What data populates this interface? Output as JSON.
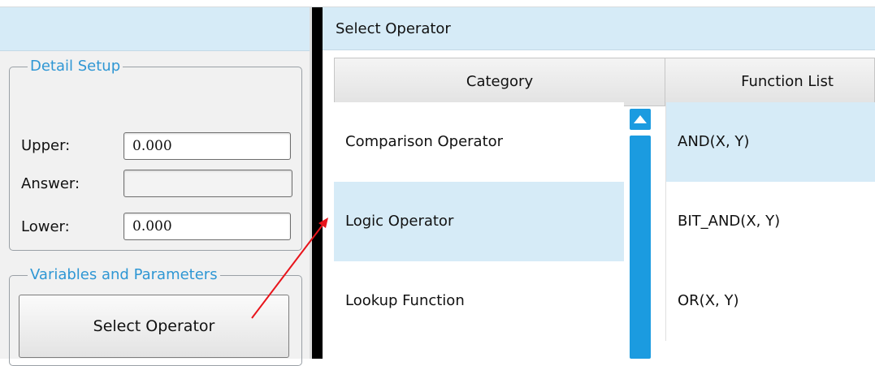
{
  "left_panel": {
    "detail_setup": {
      "legend": "Detail Setup",
      "upper_label": "Upper:",
      "upper_value": "0.000",
      "answer_label": "Answer:",
      "answer_value": "",
      "lower_label": "Lower:",
      "lower_value": "0.000"
    },
    "variables": {
      "legend": "Variables and Parameters",
      "select_operator_button": "Select Operator"
    }
  },
  "right_panel": {
    "title": "Select Operator",
    "columns": {
      "category": "Category",
      "function_list": "Function List"
    },
    "categories": [
      {
        "label": "Comparison Operator",
        "selected": false
      },
      {
        "label": "Logic Operator",
        "selected": true
      },
      {
        "label": "Lookup Function",
        "selected": false
      }
    ],
    "functions": [
      {
        "label": "AND(X, Y)",
        "selected": true
      },
      {
        "label": "BIT_AND(X, Y)",
        "selected": false
      },
      {
        "label": "OR(X, Y)",
        "selected": false
      }
    ]
  },
  "colors": {
    "header_bg": "#d6ebf7",
    "accent_blue": "#1b9be0",
    "legend_text": "#2f97d4",
    "annotation_arrow": "#e8141b"
  }
}
